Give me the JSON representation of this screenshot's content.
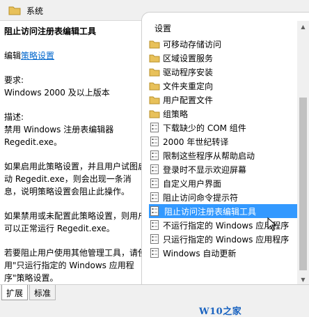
{
  "window": {
    "title": "系统",
    "icon": "folder-icon"
  },
  "description": {
    "heading": "阻止访问注册表编辑工具",
    "edit_prefix": "编辑",
    "edit_link": "策略设置",
    "requirements_label": "要求:",
    "requirements_value": "Windows 2000 及以上版本",
    "desc_label": "描述:",
    "desc_line1": "禁用 Windows 注册表编辑器",
    "desc_line2": "Regedit.exe。",
    "enabled_text": "如果启用此策略设置，并且用户试图启动 Regedit.exe，则会出现一条消息，说明策略设置会阻止此操作。",
    "disabled_text": "如果禁用或未配置此策略设置，则用户可以正常运行 Regedit.exe。",
    "other_tools_text": "若要阻止用户使用其他管理工具，请使用\"只运行指定的 Windows 应用程序\"策略设置。"
  },
  "list": {
    "header": "设置",
    "items": [
      {
        "label": "可移动存储访问",
        "icon": "folder-icon"
      },
      {
        "label": "区域设置服务",
        "icon": "folder-icon"
      },
      {
        "label": "驱动程序安装",
        "icon": "folder-icon"
      },
      {
        "label": "文件夹重定向",
        "icon": "folder-icon"
      },
      {
        "label": "用户配置文件",
        "icon": "folder-icon"
      },
      {
        "label": "组策略",
        "icon": "folder-icon"
      },
      {
        "label": "下载缺少的 COM 组件",
        "icon": "policy-setting-icon"
      },
      {
        "label": "2000 年世纪转译",
        "icon": "policy-setting-icon"
      },
      {
        "label": "限制这些程序从帮助启动",
        "icon": "policy-setting-icon"
      },
      {
        "label": "登录时不显示欢迎屏幕",
        "icon": "policy-setting-icon"
      },
      {
        "label": "自定义用户界面",
        "icon": "policy-setting-icon"
      },
      {
        "label": "阻止访问命令提示符",
        "icon": "policy-setting-icon"
      },
      {
        "label": "阻止访问注册表编辑工具",
        "icon": "policy-setting-icon",
        "selected": true
      },
      {
        "label": "不运行指定的 Windows 应用程序",
        "icon": "policy-setting-icon"
      },
      {
        "label": "只运行指定的 Windows 应用程序",
        "icon": "policy-setting-icon"
      },
      {
        "label": "Windows 自动更新",
        "icon": "policy-setting-icon"
      }
    ]
  },
  "tabs": {
    "extended": "扩展",
    "standard": "标准"
  },
  "watermark": "W10之家 W10ZJ.COM",
  "colors": {
    "selection": "#3399ff",
    "link": "#0066cc",
    "watermark": "#1a63c0",
    "folder": "#e8c15a"
  }
}
